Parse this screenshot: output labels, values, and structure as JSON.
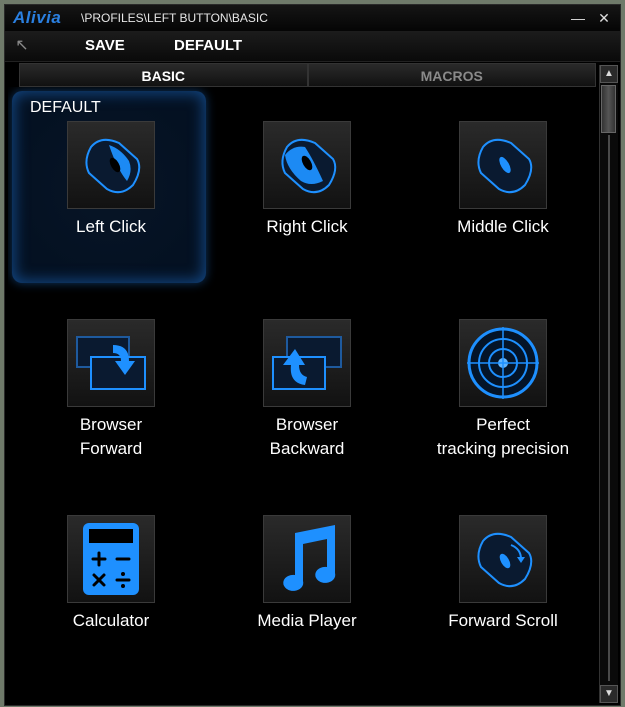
{
  "app": {
    "logo": "Alivia",
    "path": "\\PROFILES\\LEFT BUTTON\\BASIC"
  },
  "window_controls": {
    "minimize": "—",
    "close": "✕"
  },
  "toolbar": {
    "save_label": "SAVE",
    "default_label": "DEFAULT"
  },
  "tabs": [
    {
      "label": "BASIC",
      "active": true
    },
    {
      "label": "MACROS",
      "active": false
    }
  ],
  "section": {
    "label": "DEFAULT"
  },
  "items": [
    {
      "label": "Left Click",
      "icon": "mouse-left-click-icon",
      "selected": true
    },
    {
      "label": "Right Click",
      "icon": "mouse-right-click-icon",
      "selected": false
    },
    {
      "label": "Middle Click",
      "icon": "mouse-middle-click-icon",
      "selected": false
    },
    {
      "label": "Browser\nForward",
      "icon": "browser-forward-icon",
      "selected": false
    },
    {
      "label": "Browser\nBackward",
      "icon": "browser-backward-icon",
      "selected": false
    },
    {
      "label": "Perfect\ntracking precision",
      "icon": "target-icon",
      "selected": false
    },
    {
      "label": "Calculator",
      "icon": "calculator-icon",
      "selected": false
    },
    {
      "label": "Media Player",
      "icon": "music-note-icon",
      "selected": false
    },
    {
      "label": "Forward Scroll",
      "icon": "mouse-scroll-forward-icon",
      "selected": false
    }
  ],
  "colors": {
    "accent": "#1e90ff",
    "glow": "#1a6ed8",
    "background": "#000000"
  }
}
